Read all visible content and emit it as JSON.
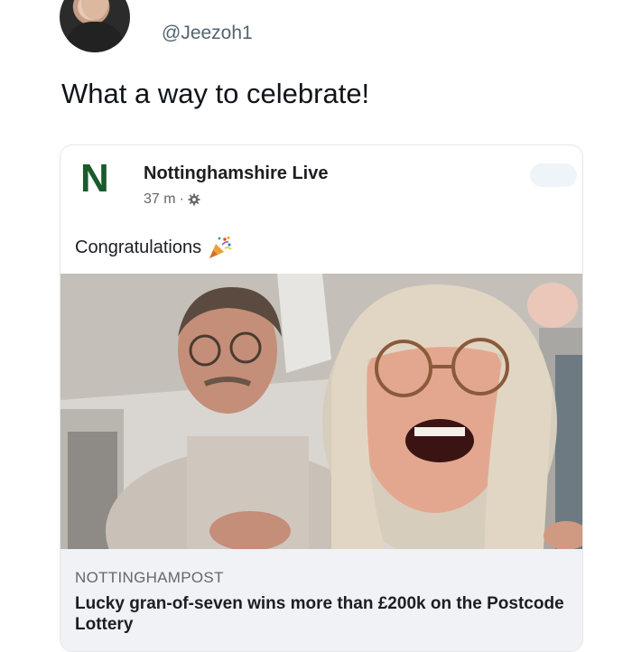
{
  "tweet": {
    "handle": "@Jeezoh1",
    "text": "What a way to celebrate!"
  },
  "card": {
    "logo_letter": "N",
    "page_name": "Nottinghamshire Live",
    "time": "37 m",
    "separator": "·",
    "privacy_icon": "gear-icon",
    "caption": "Congratulations",
    "caption_emoji": "party-popper-icon",
    "link": {
      "source": "NOTTINGHAMPOST",
      "headline": "Lucky gran-of-seven wins more than £200k on the Postcode Lottery"
    }
  },
  "colors": {
    "logo_green": "#1a5a2c",
    "link_background": "#f0f2f5",
    "secondary_text": "#65676b"
  }
}
